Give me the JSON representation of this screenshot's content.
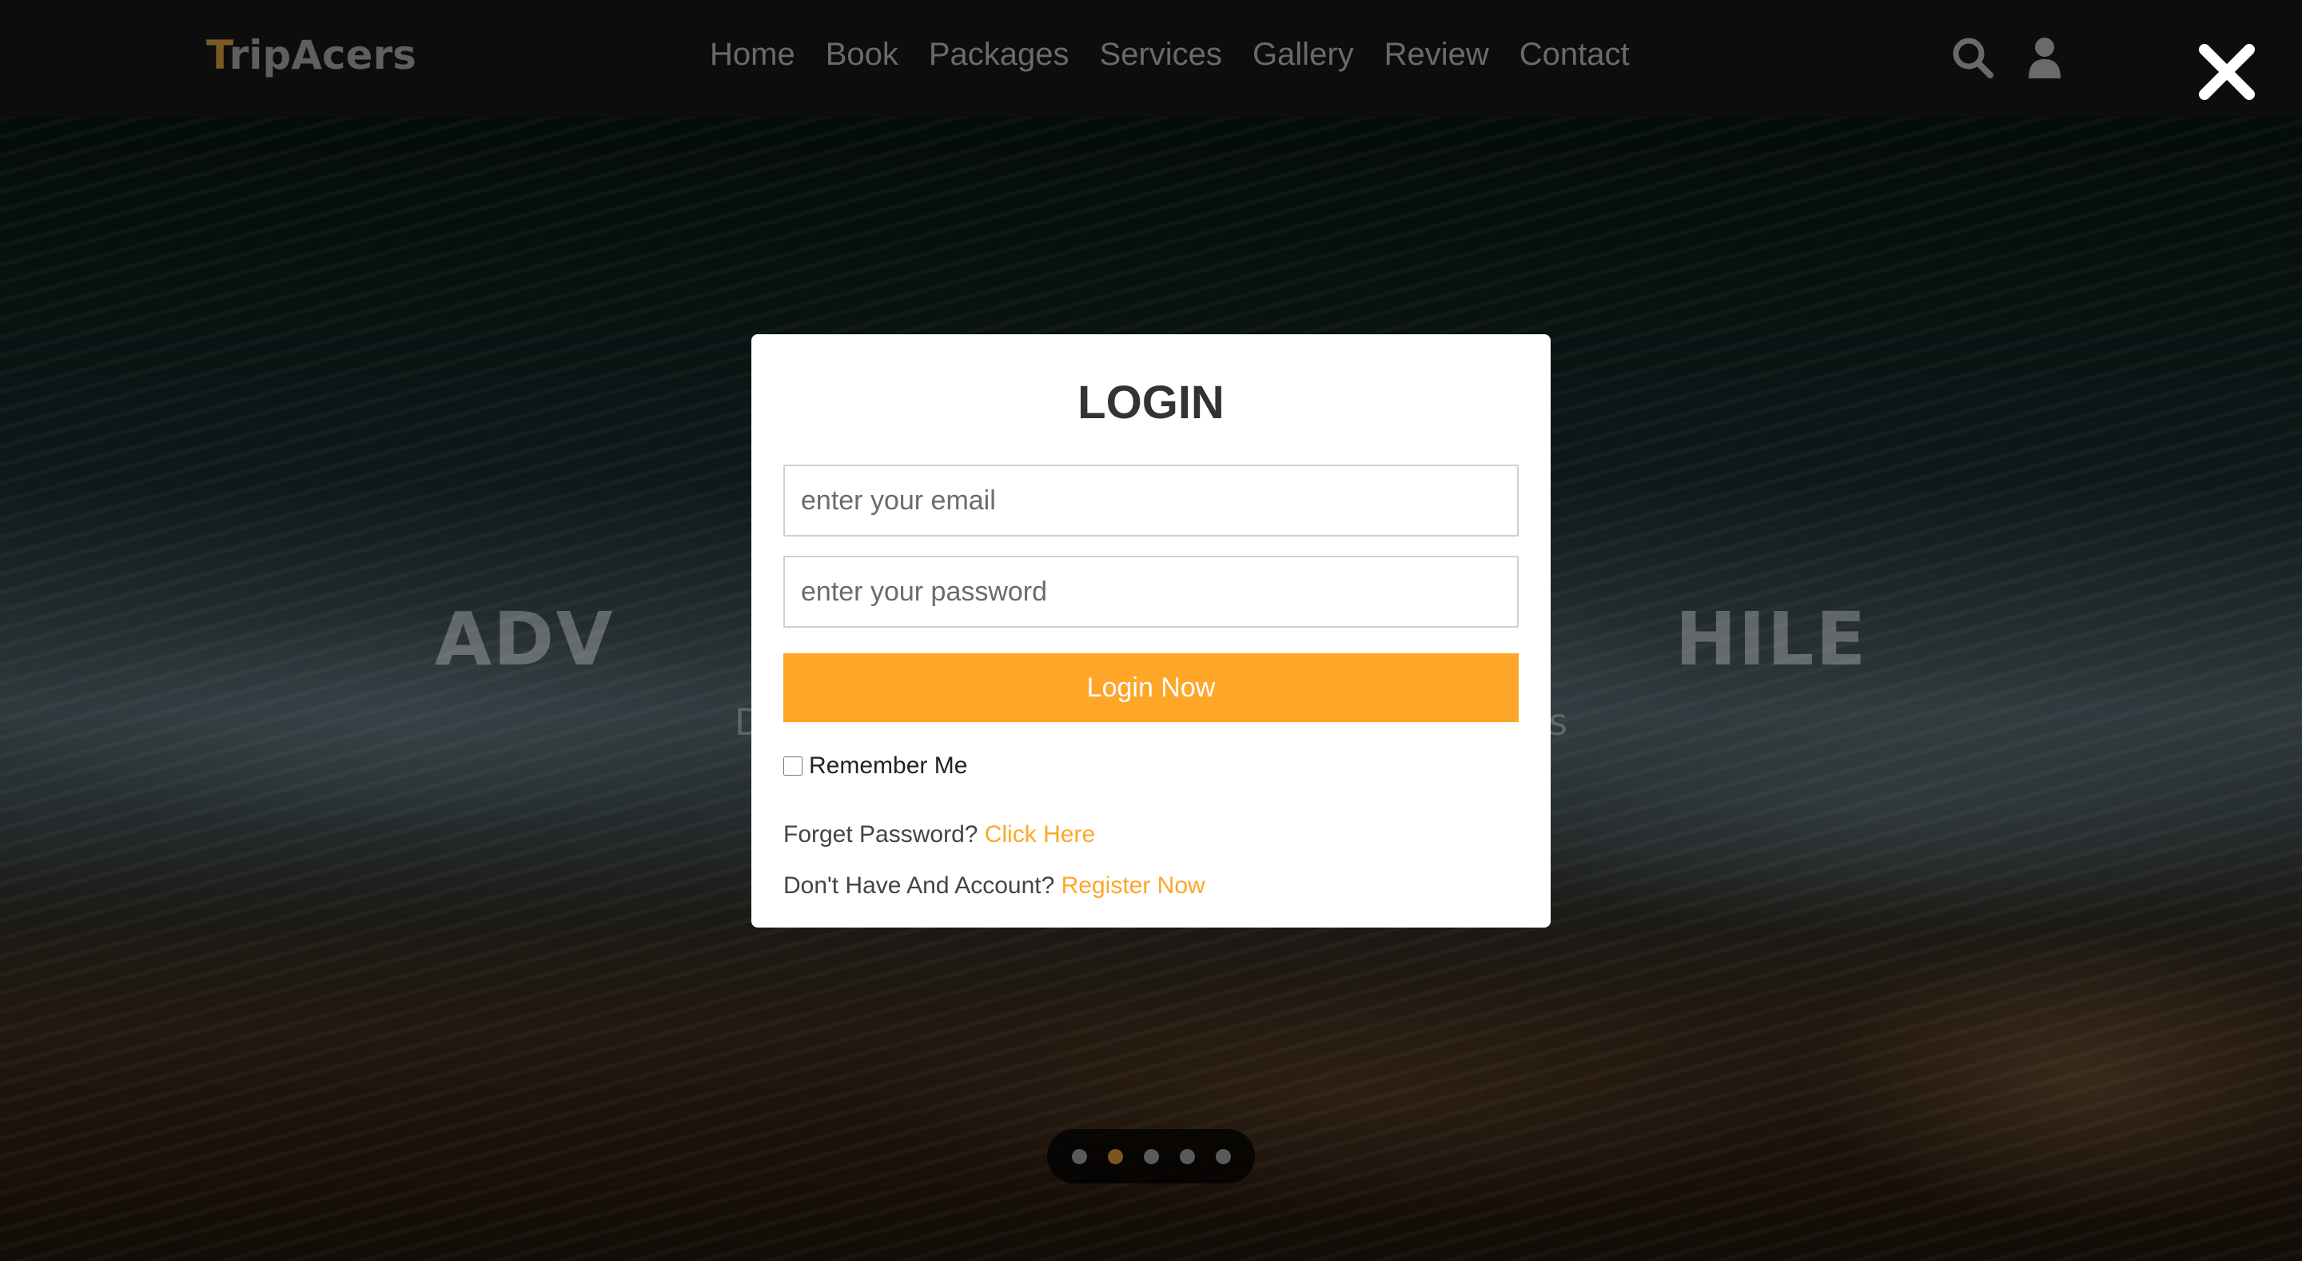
{
  "header": {
    "logo_first": "T",
    "logo_rest": "ripAcers",
    "nav": [
      "Home",
      "Book",
      "Packages",
      "Services",
      "Gallery",
      "Review",
      "Contact"
    ],
    "icons": [
      "search-icon",
      "user-icon",
      "close-icon"
    ]
  },
  "hero": {
    "title": "ADV                                       HILE",
    "subtitle": "D                                                                  ts"
  },
  "login": {
    "title": "LOGIN",
    "email_placeholder": "enter your email",
    "password_placeholder": "enter your password",
    "submit_label": "Login Now",
    "remember_label": "Remember Me",
    "forgot_text": "Forget Password?",
    "forgot_link": "Click Here",
    "register_text": "Don't Have And Account?",
    "register_link": "Register Now"
  },
  "slider": {
    "dot_count": 5,
    "active_index": 1
  },
  "colors": {
    "accent": "#ffa629",
    "header_bg": "#0d0d0d",
    "modal_bg": "#ffffff"
  }
}
